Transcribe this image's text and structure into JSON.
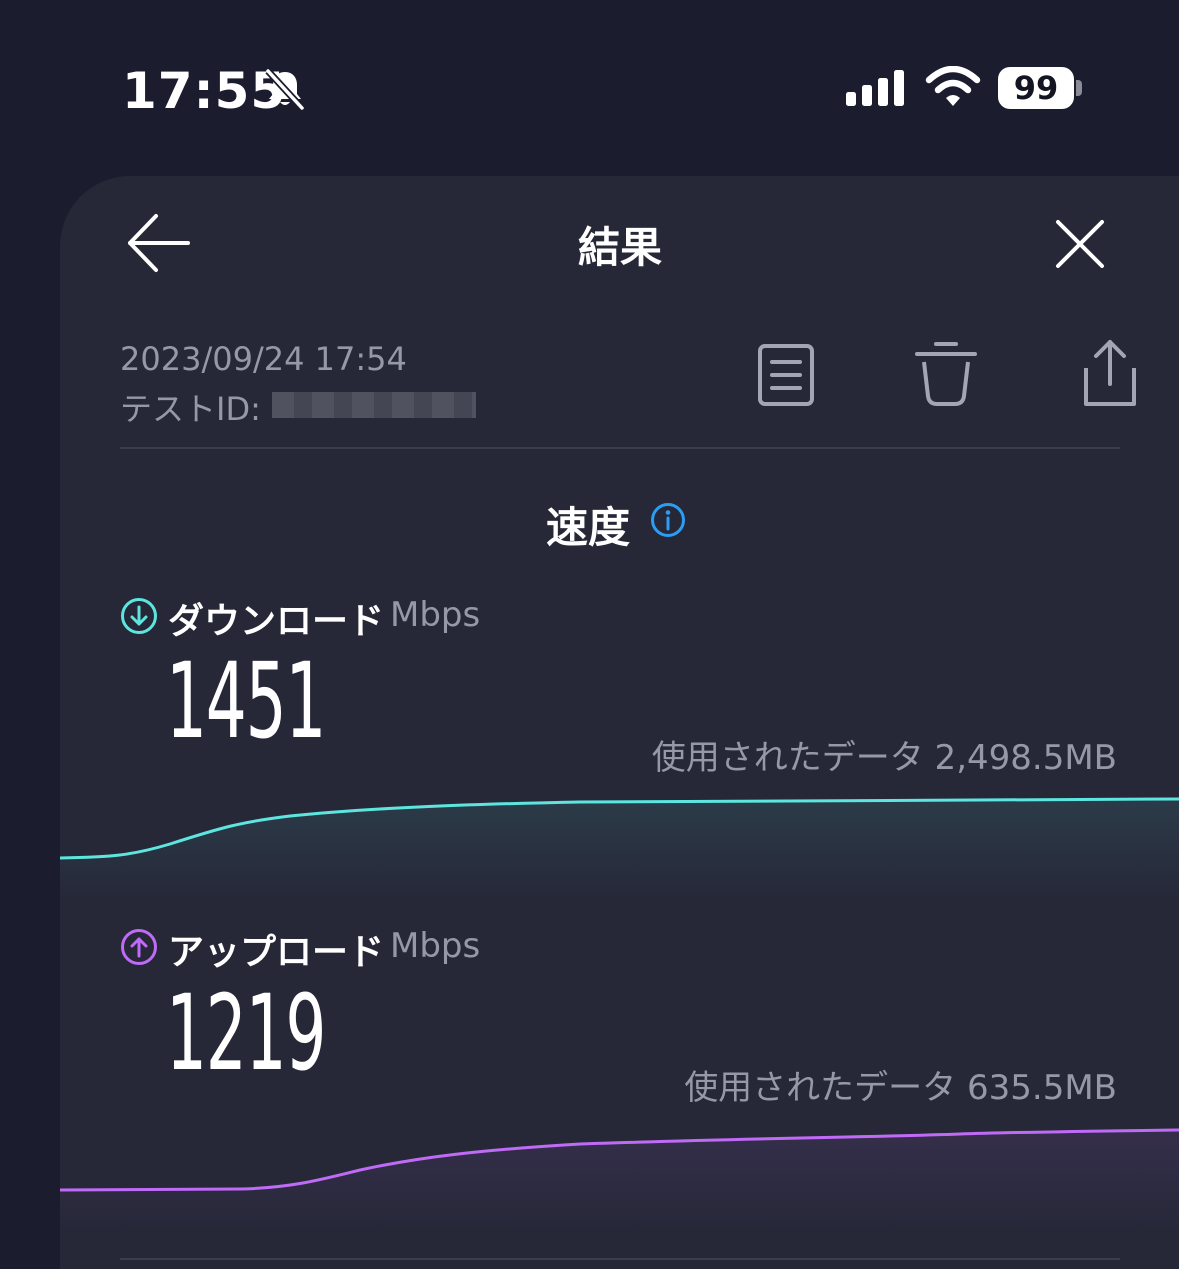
{
  "status_bar": {
    "time": "17:55",
    "battery": "99"
  },
  "header": {
    "title": "結果"
  },
  "test_info": {
    "date": "2023/09/24 17:54",
    "id_label": "テストID:"
  },
  "speed": {
    "title": "速度",
    "download": {
      "label": "ダウンロード",
      "unit": "Mbps",
      "value": "1451",
      "data_used": "使用されたデータ 2,498.5MB",
      "color": "#5de6df"
    },
    "upload": {
      "label": "アップロード",
      "unit": "Mbps",
      "value": "1219",
      "data_used": "使用されたデータ 635.5MB",
      "color": "#c06bf7"
    }
  },
  "colors": {
    "background": "#1b1c2e",
    "sheet": "#262838",
    "accent_info": "#2b9df4",
    "secondary_text": "#9698a7"
  }
}
